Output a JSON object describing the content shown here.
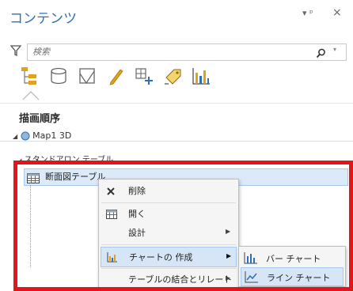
{
  "pane": {
    "title": "コンテンツ",
    "pin_glyph": "▾ ᵖ",
    "close_glyph": "×"
  },
  "search": {
    "placeholder": "検索"
  },
  "toolbar": {
    "icons": [
      "list-by-drawing-order-icon",
      "list-by-source-icon",
      "list-by-selection-icon",
      "list-by-editing-icon",
      "list-by-snapping-icon",
      "list-by-labeling-icon",
      "list-by-charts-icon"
    ]
  },
  "section": {
    "title": "描画順序",
    "map_item": "Map1 3D"
  },
  "standalone": {
    "header": "スタンドアロン テーブル",
    "selected_item": "断面図テーブル"
  },
  "context_menu": {
    "delete": "削除",
    "open": "開く",
    "design": "設計",
    "create_chart": "チャートの 作成",
    "joins_relates": "テーブルの結合とリレート"
  },
  "submenu": {
    "bar_chart": "バー チャート",
    "line_chart": "ライン チャート"
  },
  "colors": {
    "title_blue": "#2f6fb7",
    "highlight_red": "#e5141b",
    "selection_blue": "#dbe9f8",
    "icon_yellow": "#e0a21a"
  }
}
